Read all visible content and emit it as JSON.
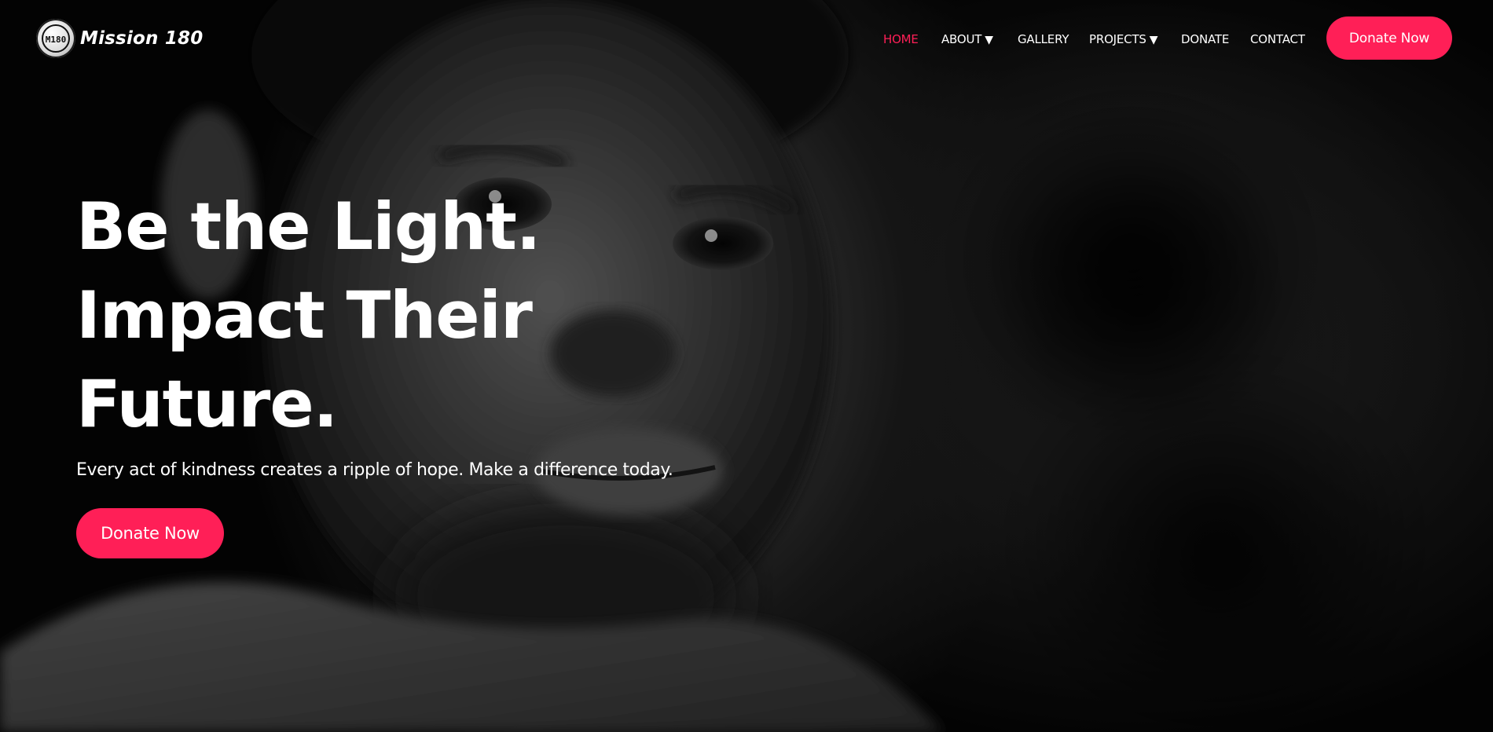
{
  "brand": {
    "name": "Mission 180",
    "logo_mark": "M180",
    "logo_icon": "mission-180-emblem"
  },
  "nav": {
    "items": [
      {
        "label": "HOME",
        "active": true
      },
      {
        "label": "ABOUT",
        "dropdown": true
      },
      {
        "label": "GALLERY"
      },
      {
        "label": "PROJECTS",
        "dropdown": true
      },
      {
        "label": "DONATE"
      },
      {
        "label": "CONTACT"
      }
    ],
    "caret": "▼",
    "cta_label": "Donate Now"
  },
  "hero": {
    "headline_lines": [
      "Be the Light.",
      "Impact Their",
      "Future."
    ],
    "subtitle": "Every act of kindness creates a ripple of hope. Make a difference today.",
    "cta_label": "Donate Now",
    "image": "black-and-white-portrait-of-child"
  },
  "colors": {
    "accent": "#ff1f57",
    "text": "#ffffff",
    "background": "#000000"
  }
}
